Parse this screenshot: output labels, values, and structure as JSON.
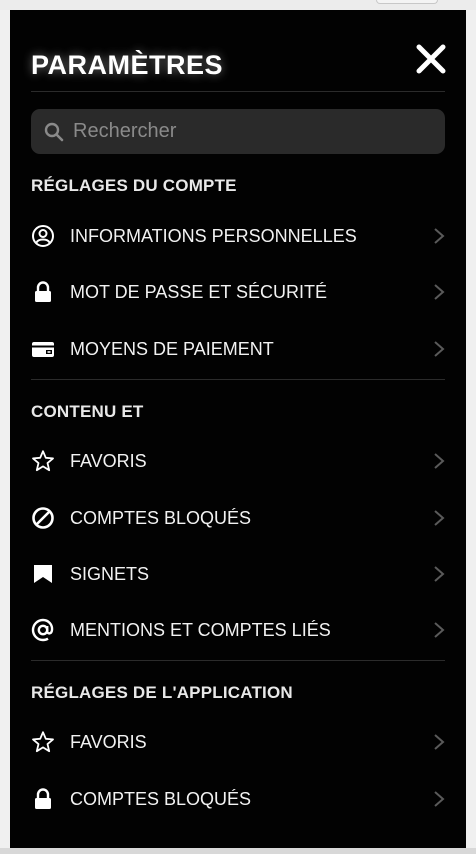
{
  "header": {
    "title": "PARAMÈTRES"
  },
  "search": {
    "placeholder": "Rechercher"
  },
  "sections": [
    {
      "title": "RÉGLAGES DU COMPTE",
      "items": [
        {
          "label": "INFORMATIONS PERSONNELLES",
          "icon": "user-circle-icon"
        },
        {
          "label": "MOT DE PASSE ET SÉCURITÉ",
          "icon": "lock-icon"
        },
        {
          "label": "MOYENS DE PAIEMENT",
          "icon": "wallet-icon"
        }
      ]
    },
    {
      "title": "CONTENU ET",
      "items": [
        {
          "label": "FAVORIS",
          "icon": "star-icon"
        },
        {
          "label": "COMPTES BLOQUÉS",
          "icon": "block-icon"
        },
        {
          "label": "SIGNETS",
          "icon": "bookmark-icon"
        },
        {
          "label": "MENTIONS ET COMPTES LIÉS",
          "icon": "at-sign-icon"
        }
      ]
    },
    {
      "title": "RÉGLAGES DE L'APPLICATION",
      "items": [
        {
          "label": "FAVORIS",
          "icon": "star-icon"
        },
        {
          "label": "COMPTES BLOQUÉS",
          "icon": "lock-icon"
        }
      ]
    }
  ],
  "colors": {
    "panel_bg": "#020202",
    "search_bg": "#2a2a2a",
    "chevron": "#5a5a5a"
  }
}
